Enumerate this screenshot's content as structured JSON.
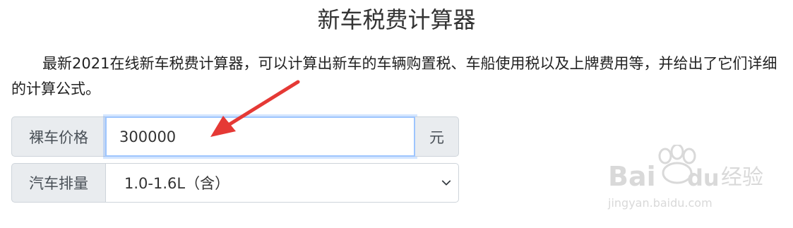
{
  "page": {
    "title": "新车税费计算器",
    "description": "最新2021在线新车税费计算器，可以计算出新车的车辆购置税、车船使用税以及上牌费用等，并给出了它们详细的计算公式。"
  },
  "form": {
    "price": {
      "label": "裸车价格",
      "value": "300000",
      "unit": "元"
    },
    "displacement": {
      "label": "汽车排量",
      "selected": "1.0-1.6L（含）"
    }
  },
  "watermark": {
    "brand_a": "Bai",
    "brand_b": "du",
    "brand_c": "经验",
    "url": "jingyan.baidu.com"
  },
  "colors": {
    "arrow": "#e53935",
    "focus_border": "#9ec5fe",
    "addon_bg": "#e9ecef"
  },
  "icons": {
    "select_chevron": "chevron-down-icon",
    "annotation": "red-arrow-icon",
    "watermark_logo": "baidu-paw-icon"
  }
}
